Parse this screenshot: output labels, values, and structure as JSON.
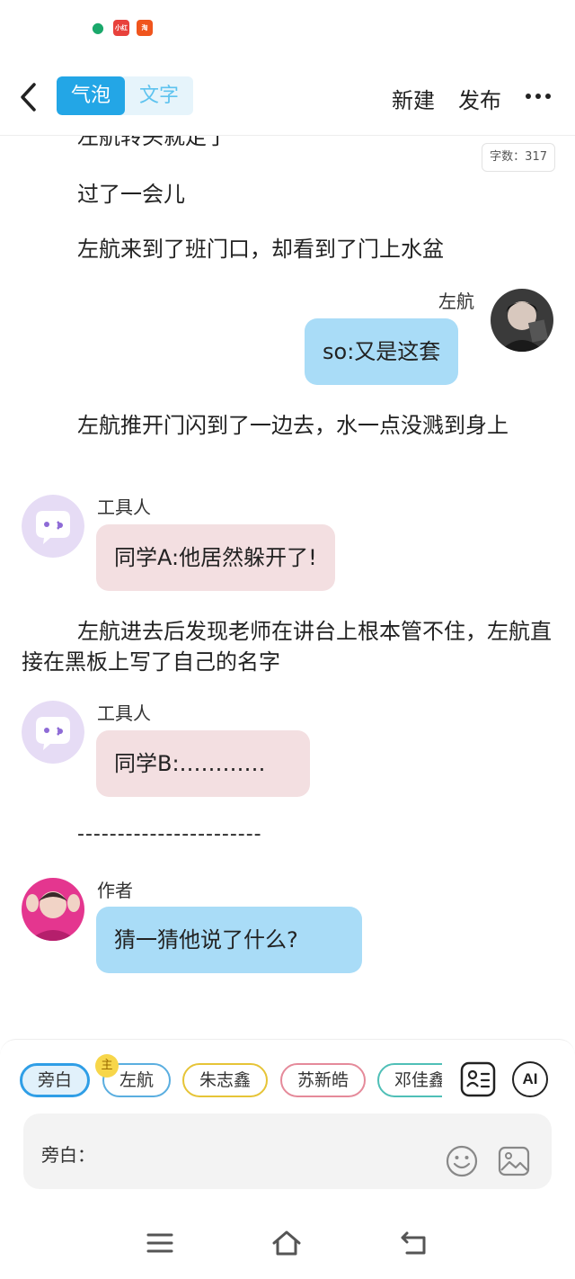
{
  "status_bar": {
    "icons": [
      "app-green-icon",
      "xiaohongshu-icon",
      "taobao-icon"
    ],
    "icon_labels": [
      "",
      "小红书",
      "淘"
    ]
  },
  "header": {
    "tabs": [
      {
        "label": "气泡",
        "active": true
      },
      {
        "label": "文字",
        "active": false
      }
    ],
    "new_label": "新建",
    "publish_label": "发布"
  },
  "word_count": "字数：317",
  "content": {
    "narration_1_partial": "左航转头就走了",
    "narration_2": "过了一会儿",
    "narration_3": "左航来到了班门口，却看到了门上水盆",
    "msg_1": {
      "speaker": "左航",
      "text": "so:又是这套"
    },
    "narration_4": "左航推开门闪到了一边去，水一点没溅到身上",
    "msg_2": {
      "speaker": "工具人",
      "text": "同学A:他居然躲开了!"
    },
    "narration_5": "左航进去后发现老师在讲台上根本管不住，左航直接在黑板上写了自己的名字",
    "msg_3": {
      "speaker": "工具人",
      "text": "同学B:…………"
    },
    "separator": "-----------------------",
    "msg_4": {
      "speaker": "作者",
      "text": "猜一猜他说了什么?"
    }
  },
  "bottom": {
    "chips": [
      {
        "label": "旁白",
        "selected": true,
        "color": "#2f9ee6"
      },
      {
        "label": "左航",
        "selected": false,
        "color": "#5aaee0"
      },
      {
        "label": "朱志鑫",
        "selected": false,
        "color": "#e6c437"
      },
      {
        "label": "苏新皓",
        "selected": false,
        "color": "#e58a9a"
      },
      {
        "label": "邓佳鑫",
        "selected": false,
        "color": "#4fbfb7"
      }
    ],
    "host_badge": "主",
    "ai_label": "AI",
    "input_label": "旁白："
  },
  "colors": {
    "accent": "#23a6e6",
    "bubble_blue": "#a9dcf7",
    "bubble_pink": "#f3dfe1"
  }
}
